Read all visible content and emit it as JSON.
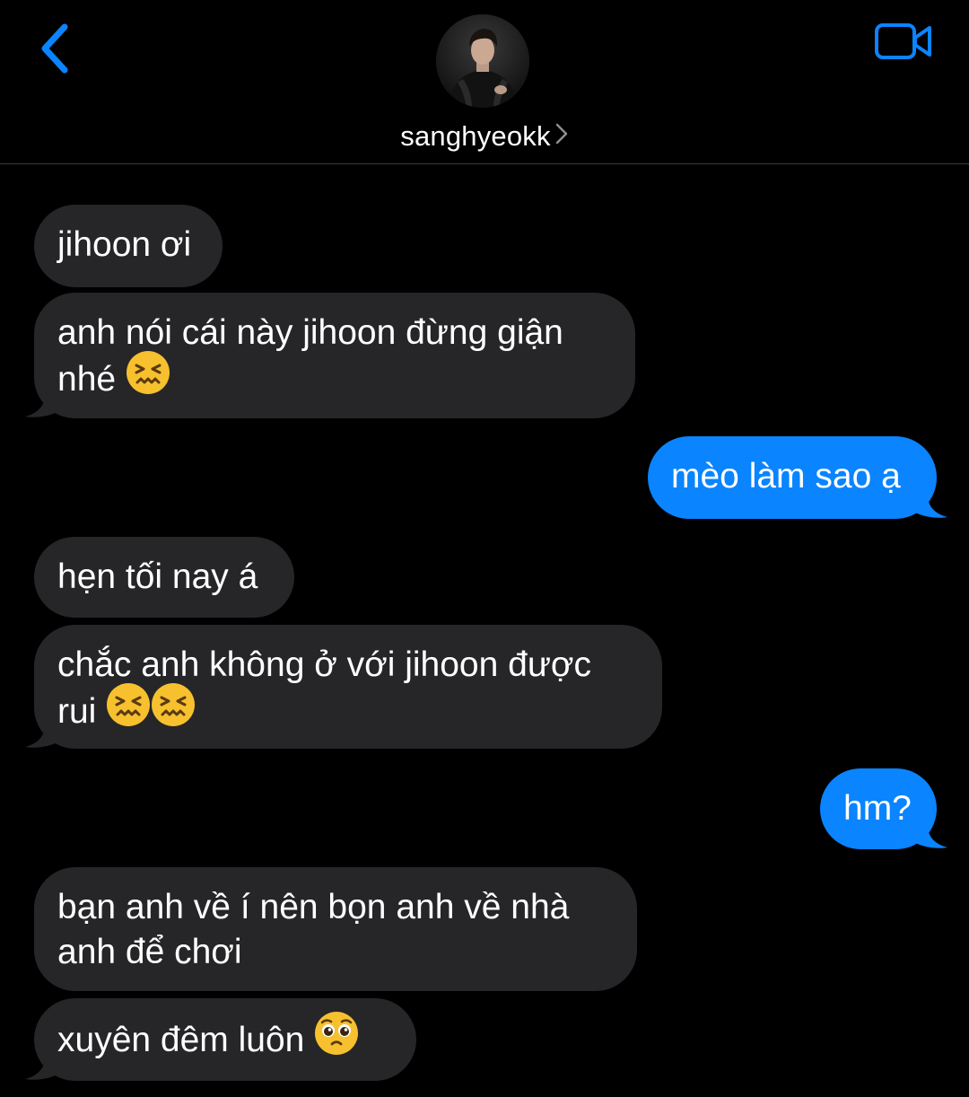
{
  "header": {
    "contact_name": "sanghyeokk",
    "back_icon": "chevron-left-icon",
    "video_icon": "video-camera-icon",
    "accent_color": "#0a84ff"
  },
  "messages": [
    {
      "side": "in",
      "text": "jihoon ơi"
    },
    {
      "side": "in",
      "lines": [
        "anh nói cái này jihoon đừng giận",
        "nhé"
      ],
      "emoji": [
        "confounded-face-emoji"
      ]
    },
    {
      "side": "out",
      "text": "mèo làm sao ạ"
    },
    {
      "side": "in",
      "text": "hẹn tối nay á"
    },
    {
      "side": "in",
      "lines": [
        "chắc anh không ở với jihoon được",
        "rui"
      ],
      "emoji": [
        "confounded-face-emoji",
        "confounded-face-emoji"
      ]
    },
    {
      "side": "out",
      "text": "hm?"
    },
    {
      "side": "in",
      "lines": [
        "bạn anh về í nên bọn anh về nhà",
        "anh để chơi"
      ]
    },
    {
      "side": "in",
      "text": "xuyên đêm luôn",
      "emoji": [
        "pleading-face-emoji"
      ]
    }
  ],
  "colors": {
    "incoming_bubble": "#262628",
    "outgoing_bubble": "#0a84ff",
    "background": "#000000"
  }
}
